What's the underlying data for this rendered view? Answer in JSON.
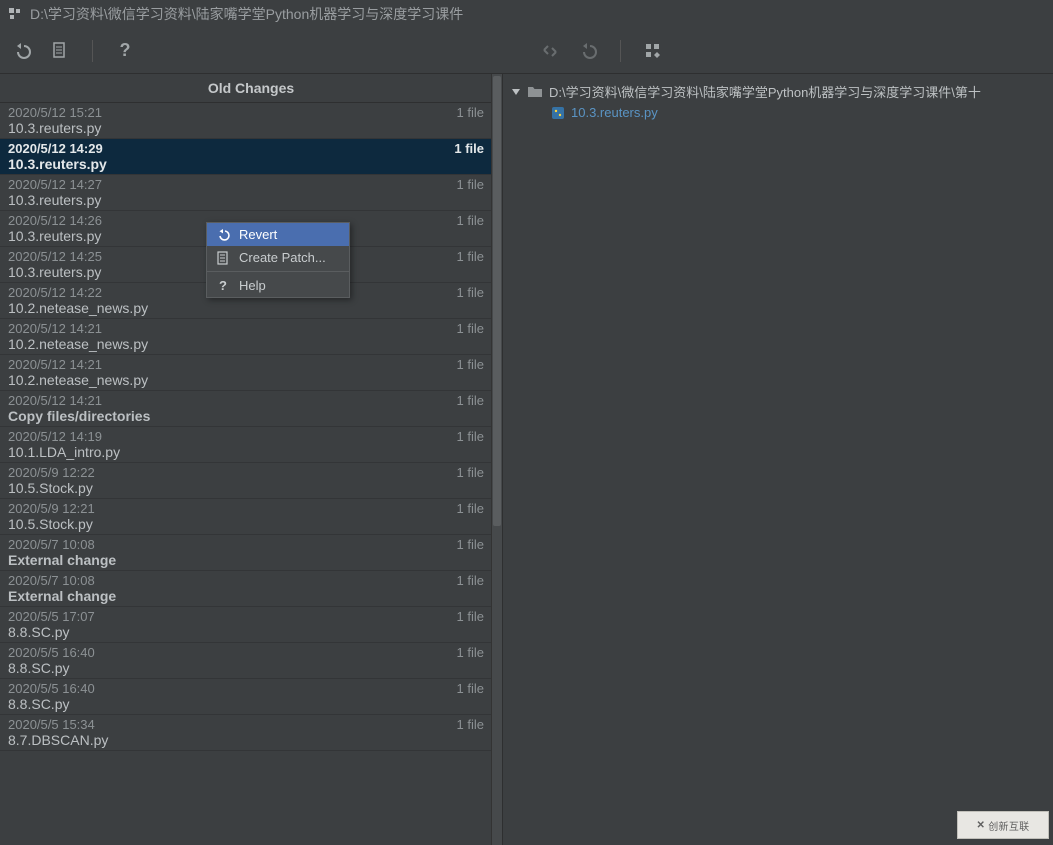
{
  "window": {
    "title": "D:\\学习资料\\微信学习资料\\陆家嘴学堂Python机器学习与深度学习课件"
  },
  "list_header": "Old Changes",
  "context_menu": {
    "revert": "Revert",
    "create_patch": "Create Patch...",
    "help": "Help"
  },
  "right_panel": {
    "folder_path": "D:\\学习资料\\微信学习资料\\陆家嘴学堂Python机器学习与深度学习课件\\第十",
    "file_name": "10.3.reuters.py"
  },
  "history": [
    {
      "date": "2020/5/12 15:21",
      "label": "10.3.reuters.py",
      "count": "1 file",
      "bold": false,
      "selected": false
    },
    {
      "date": "2020/5/12 14:29",
      "label": "10.3.reuters.py",
      "count": "1 file",
      "bold": false,
      "selected": true
    },
    {
      "date": "2020/5/12 14:27",
      "label": "10.3.reuters.py",
      "count": "1 file",
      "bold": false,
      "selected": false
    },
    {
      "date": "2020/5/12 14:26",
      "label": "10.3.reuters.py",
      "count": "1 file",
      "bold": false,
      "selected": false
    },
    {
      "date": "2020/5/12 14:25",
      "label": "10.3.reuters.py",
      "count": "1 file",
      "bold": false,
      "selected": false
    },
    {
      "date": "2020/5/12 14:22",
      "label": "10.2.netease_news.py",
      "count": "1 file",
      "bold": false,
      "selected": false
    },
    {
      "date": "2020/5/12 14:21",
      "label": "10.2.netease_news.py",
      "count": "1 file",
      "bold": false,
      "selected": false
    },
    {
      "date": "2020/5/12 14:21",
      "label": "10.2.netease_news.py",
      "count": "1 file",
      "bold": false,
      "selected": false
    },
    {
      "date": "2020/5/12 14:21",
      "label": "Copy files/directories",
      "count": "1 file",
      "bold": true,
      "selected": false
    },
    {
      "date": "2020/5/12 14:19",
      "label": "10.1.LDA_intro.py",
      "count": "1 file",
      "bold": false,
      "selected": false
    },
    {
      "date": "2020/5/9 12:22",
      "label": "10.5.Stock.py",
      "count": "1 file",
      "bold": false,
      "selected": false
    },
    {
      "date": "2020/5/9 12:21",
      "label": "10.5.Stock.py",
      "count": "1 file",
      "bold": false,
      "selected": false
    },
    {
      "date": "2020/5/7 10:08",
      "label": "External change",
      "count": "1 file",
      "bold": true,
      "selected": false
    },
    {
      "date": "2020/5/7 10:08",
      "label": "External change",
      "count": "1 file",
      "bold": true,
      "selected": false
    },
    {
      "date": "2020/5/5 17:07",
      "label": "8.8.SC.py",
      "count": "1 file",
      "bold": false,
      "selected": false
    },
    {
      "date": "2020/5/5 16:40",
      "label": "8.8.SC.py",
      "count": "1 file",
      "bold": false,
      "selected": false
    },
    {
      "date": "2020/5/5 16:40",
      "label": "8.8.SC.py",
      "count": "1 file",
      "bold": false,
      "selected": false
    },
    {
      "date": "2020/5/5 15:34",
      "label": "8.7.DBSCAN.py",
      "count": "1 file",
      "bold": false,
      "selected": false
    }
  ],
  "watermark": "创新互联"
}
